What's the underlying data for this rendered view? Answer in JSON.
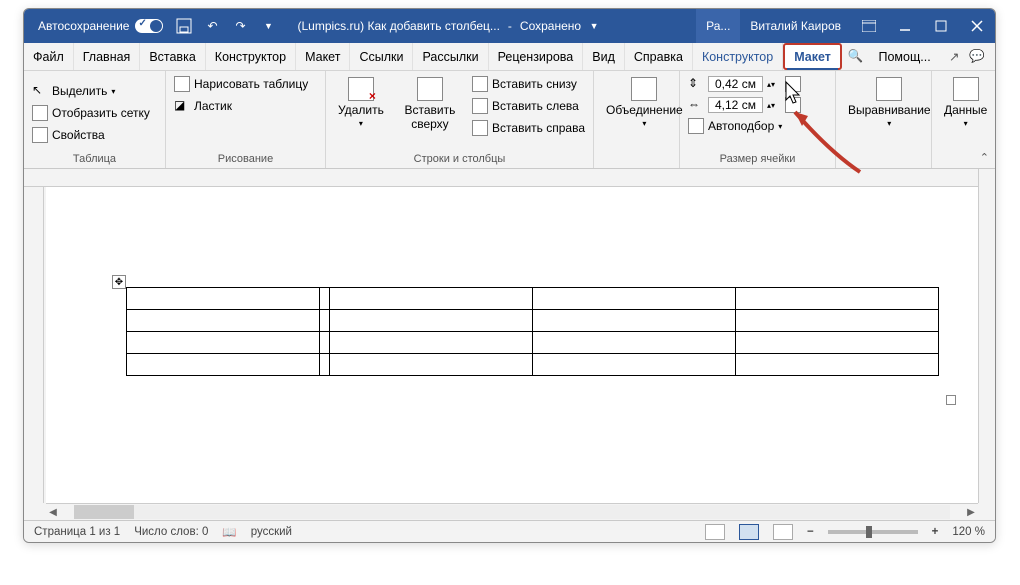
{
  "titlebar": {
    "autosave": "Автосохранение",
    "doc_title": "(Lumpics.ru) Как добавить столбец...",
    "saved_status": "Сохранено",
    "acc_short": "Ра...",
    "user": "Виталий Каиров"
  },
  "tabs": {
    "file": "Файл",
    "home": "Главная",
    "insert": "Вставка",
    "designer": "Конструктор",
    "layout": "Макет",
    "refs": "Ссылки",
    "mail": "Рассылки",
    "review": "Рецензирова",
    "view": "Вид",
    "help": "Справка",
    "table_design": "Конструктор",
    "table_layout": "Макет",
    "search_placeholder": "Помощ..."
  },
  "ribbon": {
    "table": {
      "select": "Выделить",
      "grid": "Отобразить сетку",
      "props": "Свойства",
      "label": "Таблица"
    },
    "draw": {
      "draw": "Нарисовать таблицу",
      "eraser": "Ластик",
      "label": "Рисование"
    },
    "rc": {
      "delete": "Удалить",
      "ins_top": "Вставить сверху",
      "ins_bottom": "Вставить снизу",
      "ins_left": "Вставить слева",
      "ins_right": "Вставить справа",
      "label": "Строки и столбцы"
    },
    "merge": {
      "merge": "Объединение",
      "label": ""
    },
    "cellsize": {
      "h": "0,42 см",
      "w": "4,12 см",
      "autofit": "Автоподбор",
      "label": "Размер ячейки"
    },
    "align": {
      "label_txt": "Выравнивание"
    },
    "data": {
      "label_txt": "Данные"
    }
  },
  "status": {
    "page": "Страница 1 из 1",
    "words": "Число слов: 0",
    "lang": "русский",
    "zoom": "120 %"
  }
}
